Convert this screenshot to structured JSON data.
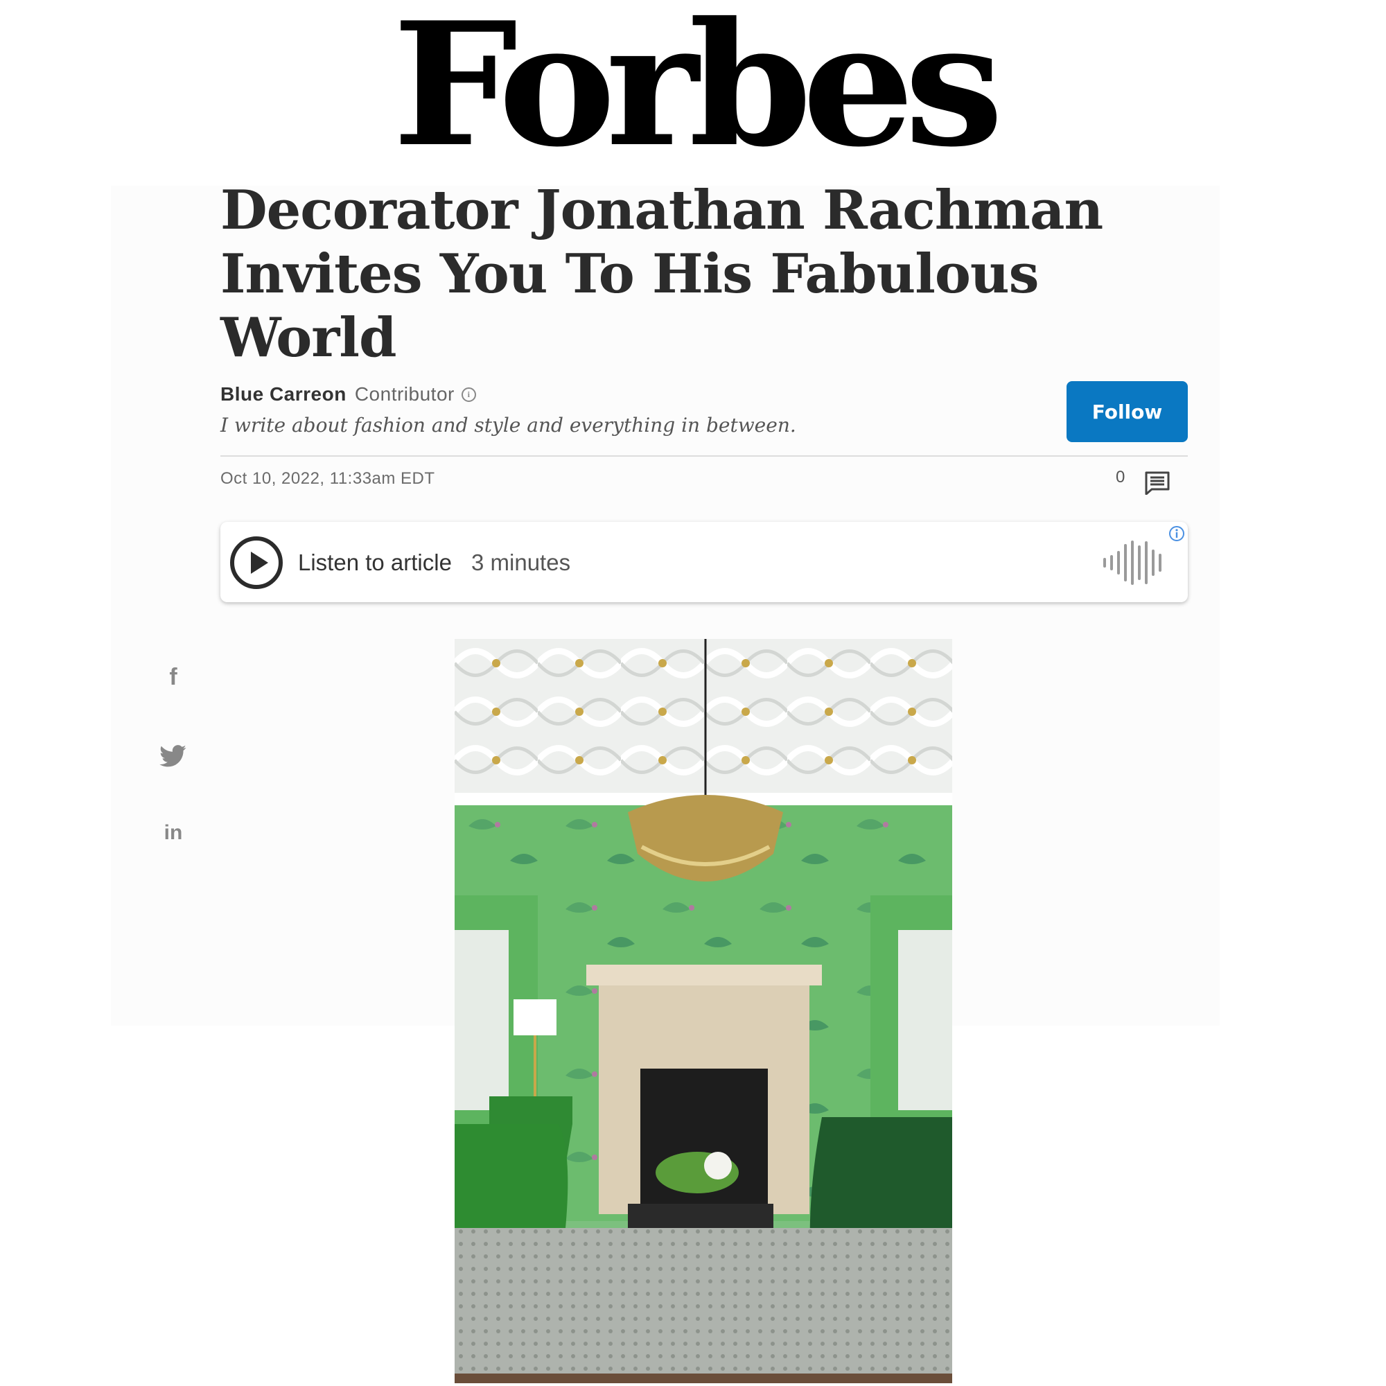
{
  "masthead": {
    "logo_text": "Forbes"
  },
  "article": {
    "headline_line1": "Decorator Jonathan Rachman",
    "headline_line2": "Invites You To His Fabulous World",
    "author": {
      "name": "Blue Carreon",
      "role": "Contributor",
      "info_icon": "i",
      "bio": "I write about fashion and style and everything in between."
    },
    "follow_label": "Follow",
    "date": "Oct 10, 2022, 11:33am EDT",
    "comment_count": "0",
    "listen": {
      "label": "Listen to article",
      "duration": "3 minutes"
    }
  },
  "share": {
    "facebook": "f",
    "linkedin": "in"
  },
  "icons": [
    "info-icon",
    "comment-icon",
    "play-icon",
    "waveform-icon",
    "ad-info-icon",
    "facebook-icon",
    "twitter-icon",
    "linkedin-icon"
  ],
  "colors": {
    "follow_button": "#0a78c2",
    "ad_info": "#4a90e2",
    "photo_wall": "#6dbb6e",
    "sofa": "#1f5a2c"
  }
}
